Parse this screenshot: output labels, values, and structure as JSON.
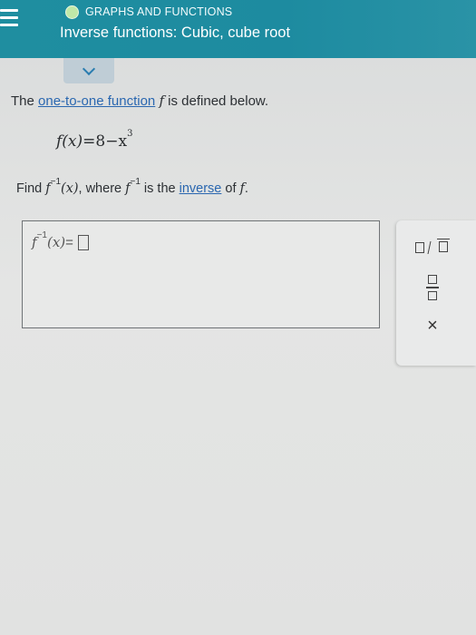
{
  "header": {
    "topic_label": "GRAPHS AND FUNCTIONS",
    "lesson_title": "Inverse functions: Cubic, cube root"
  },
  "problem": {
    "statement_prefix": "The ",
    "statement_link": "one-to-one function",
    "statement_var": "f",
    "statement_suffix": " is defined below.",
    "definition_lhs": "f(x)",
    "definition_rhs_pre": "=8−x",
    "definition_exponent": "3",
    "find_prefix": "Find ",
    "find_f": "f",
    "inverse_exponent": "−1",
    "find_arg": "(x)",
    "find_mid": ", where ",
    "find_f2": "f",
    "find_is": " is the ",
    "inverse_link": "inverse",
    "find_of": " of ",
    "find_f3": "f",
    "find_end": "."
  },
  "answer": {
    "lhs_f": "f",
    "lhs_exponent": "−1",
    "lhs_arg": "(x)",
    "equals": " = "
  },
  "palette": {
    "items": [
      "sqrt-template",
      "fraction-template",
      "clear"
    ],
    "clear_label": "×"
  },
  "colors": {
    "header_bg": "#1f8ea0",
    "link": "#2a67b0",
    "topic_dot": "#bfe8a8",
    "collapse_tab": "#bfcdd6"
  },
  "icons": [
    "hamburger-icon",
    "topic-dot-icon",
    "chevron-down-icon",
    "sqrt-icon",
    "fraction-icon",
    "close-icon"
  ]
}
